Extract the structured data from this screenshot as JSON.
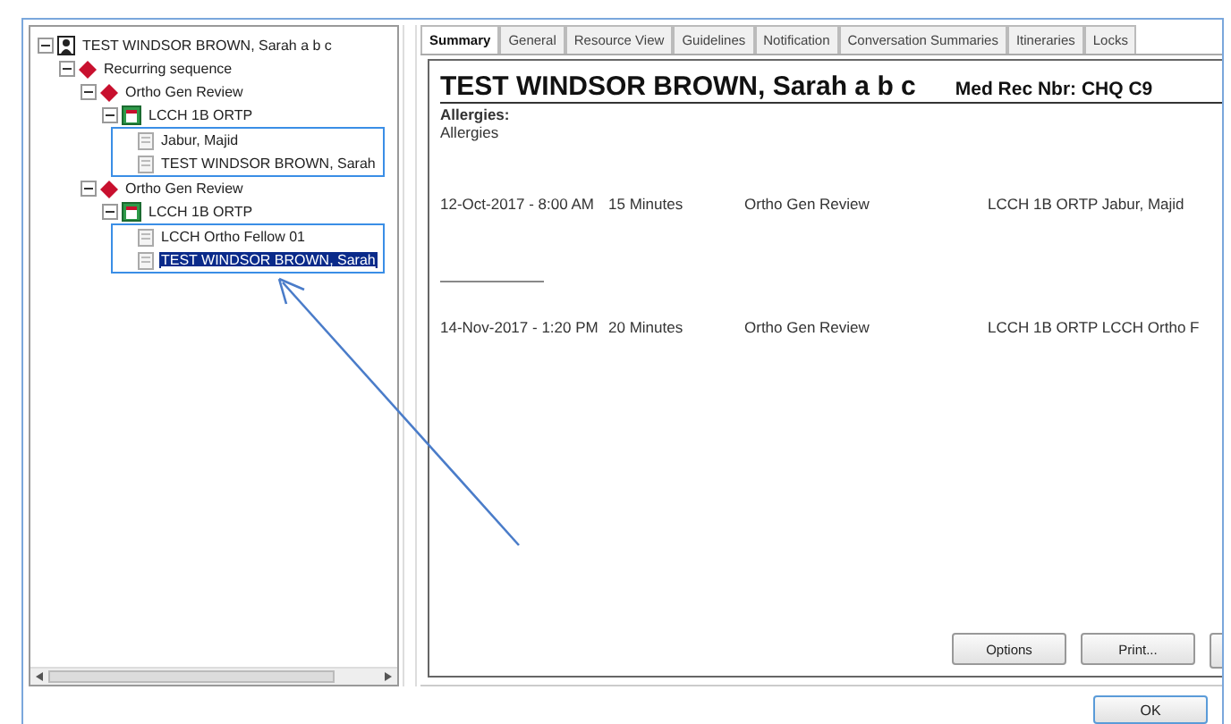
{
  "tree": [
    {
      "label": "TEST WINDSOR BROWN, Sarah a b c",
      "kind": "patient",
      "expanded": true,
      "selected": false,
      "children": [
        {
          "label": "Recurring sequence",
          "kind": "sequence",
          "expanded": true,
          "selected": false,
          "children": [
            {
              "label": "Ortho Gen Review",
              "kind": "review",
              "expanded": true,
              "selected": false,
              "children": [
                {
                  "label": "LCCH 1B ORTP",
                  "kind": "resource",
                  "expanded": true,
                  "selected": false,
                  "children": [
                    {
                      "label": "Jabur, Majid",
                      "kind": "person",
                      "selected": false
                    },
                    {
                      "label": "TEST WINDSOR BROWN, Sarah",
                      "kind": "person",
                      "selected": false
                    }
                  ]
                }
              ]
            },
            {
              "label": "Ortho Gen Review",
              "kind": "review",
              "expanded": true,
              "selected": false,
              "children": [
                {
                  "label": "LCCH 1B ORTP",
                  "kind": "resource",
                  "expanded": true,
                  "selected": false,
                  "children": [
                    {
                      "label": "LCCH Ortho Fellow 01",
                      "kind": "person",
                      "selected": false
                    },
                    {
                      "label": "TEST WINDSOR BROWN, Sarah",
                      "kind": "person",
                      "selected": true
                    }
                  ]
                }
              ]
            }
          ]
        }
      ]
    }
  ],
  "tabs": [
    {
      "label": "Summary",
      "selected": true
    },
    {
      "label": "General",
      "selected": false
    },
    {
      "label": "Resource View",
      "selected": false
    },
    {
      "label": "Guidelines",
      "selected": false
    },
    {
      "label": "Notification",
      "selected": false
    },
    {
      "label": "Conversation Summaries",
      "selected": false
    },
    {
      "label": "Itineraries",
      "selected": false
    },
    {
      "label": "Locks",
      "selected": false
    }
  ],
  "summary": {
    "patient_name": "TEST WINDSOR BROWN, Sarah a b c",
    "med_rec": "Med Rec Nbr: CHQ C9",
    "allergies_heading": "Allergies:",
    "allergies": "Allergies",
    "appointments": [
      {
        "date": "12-Oct-2017 - 8:00 AM",
        "duration": "15 Minutes",
        "type": "Ortho Gen Review",
        "resource": "LCCH 1B ORTP Jabur, Majid"
      },
      {
        "date": "14-Nov-2017 - 1:20 PM",
        "duration": "20 Minutes",
        "type": "Ortho Gen Review",
        "resource": "LCCH 1B ORTP LCCH Ortho F"
      }
    ]
  },
  "buttons": [
    "Options",
    "Print..."
  ],
  "ok_button": "OK"
}
